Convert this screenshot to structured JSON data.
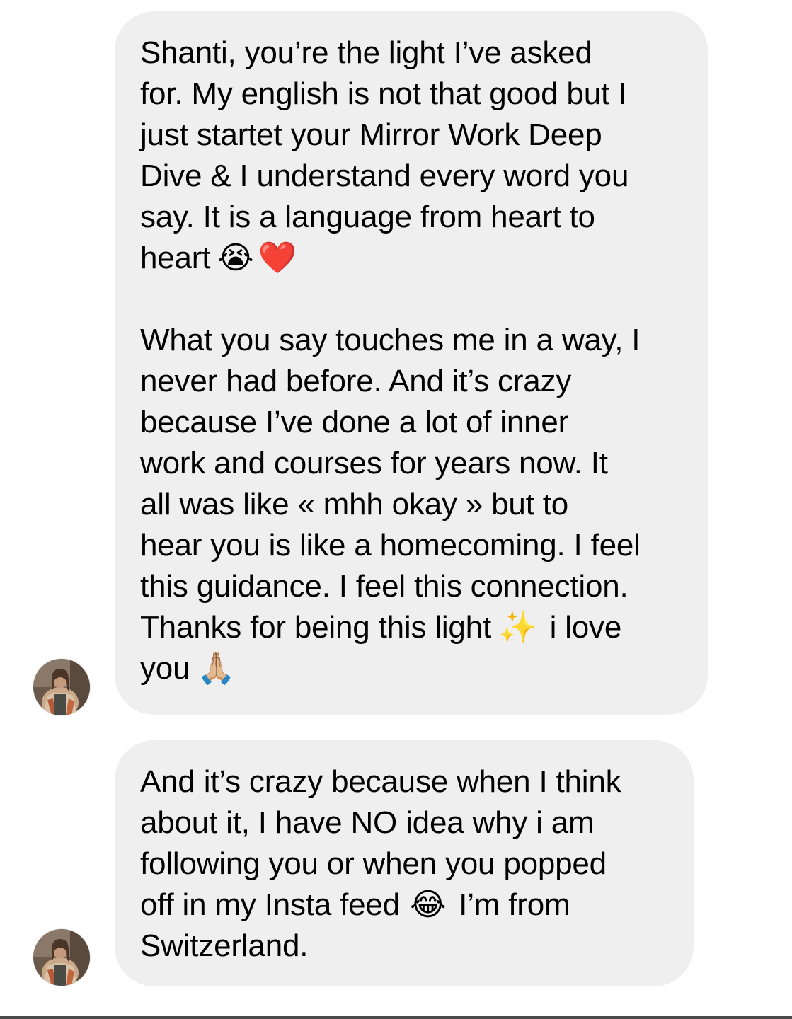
{
  "messages": [
    {
      "paragraphs": [
        [
          "Shanti, you’re the light I’ve asked",
          "for. My english is not that good but I",
          "just startet your Mirror Work Deep",
          "Dive & I understand every word you",
          "say. It is a language from heart to",
          "heart"
        ],
        [
          "What you say touches me in a way, I",
          "never had before. And it’s crazy",
          "because I’ve done a lot of inner",
          "work and courses for years now. It",
          "all was like « mhh okay » but to",
          "hear you is like a homecoming. I feel",
          "this guidance. I feel this connection.",
          "Thanks for being this light",
          "you"
        ]
      ],
      "inline": {
        "p1_emoji_a": "😭",
        "p1_emoji_b": "❤️",
        "p2_sparkles": "✨",
        "p2_after_sparkles": "i love",
        "p2_pray": "🙏🏼"
      }
    },
    {
      "lines": [
        "And it’s crazy because when I think",
        "about it, I have NO idea why i am",
        "following you or when you popped",
        "off in my Insta feed",
        "Switzerland."
      ],
      "inline": {
        "laugh_emoji": "😂",
        "after_laugh": "I’m from"
      }
    }
  ],
  "avatar_icon": "user-avatar-photo",
  "colors": {
    "bubble": "#efefef",
    "text": "#000000",
    "background": "#ffffff"
  }
}
